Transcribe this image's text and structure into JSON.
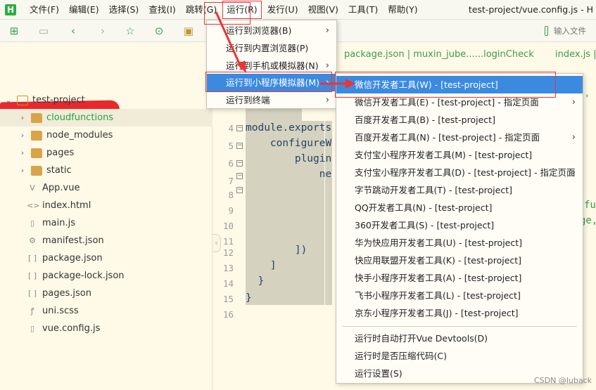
{
  "menubar": {
    "logo": "H",
    "items": [
      "文件(F)",
      "编辑(E)",
      "选择(S)",
      "查找(I)",
      "跳转(G)",
      "运行(R)",
      "发行(U)",
      "视图(V)",
      "工具(T)",
      "帮助(Y)"
    ],
    "title": "test-project/vue.config.js - H"
  },
  "toolbar": {
    "search_placeholder": "输入文件"
  },
  "sidebar": {
    "items": [
      {
        "label": "test-project",
        "type": "project",
        "arrow": "⌄"
      },
      {
        "label": "cloudfunctions",
        "type": "folder",
        "arrow": "›"
      },
      {
        "label": "node_modules",
        "type": "folder",
        "arrow": "›"
      },
      {
        "label": "pages",
        "type": "folder",
        "arrow": "›"
      },
      {
        "label": "static",
        "type": "folder",
        "arrow": "›"
      },
      {
        "label": "App.vue",
        "type": "vue",
        "icon": "V"
      },
      {
        "label": "index.html",
        "type": "html",
        "icon": "<>"
      },
      {
        "label": "main.js",
        "type": "file",
        "icon": "▯"
      },
      {
        "label": "manifest.json",
        "type": "json",
        "icon": "⚙"
      },
      {
        "label": "package.json",
        "type": "json",
        "icon": "[ ]"
      },
      {
        "label": "package-lock.json",
        "type": "json",
        "icon": "[ ]"
      },
      {
        "label": "pages.json",
        "type": "json",
        "icon": "[ ]"
      },
      {
        "label": "uni.scss",
        "type": "scss",
        "icon": "ꝭ"
      },
      {
        "label": "vue.config.js",
        "type": "file",
        "icon": "▯"
      }
    ]
  },
  "editor": {
    "tab_a": "package.json | muxin_jube......loginCheck",
    "tab_b": "index.js |",
    "line_numbers": [
      "4",
      "5",
      "6",
      "7",
      "8",
      "9",
      "10",
      "11",
      "12",
      "13",
      "14",
      "15",
      "16"
    ],
    "code_lines": [
      "module.exports",
      "    configureW",
      "        plugin",
      "            ne",
      "",
      "",
      "",
      "",
      "        ])",
      "    ]",
      "  }",
      "}",
      ""
    ],
    "right_fragments": [
      "'",
      "fur",
      "ge,"
    ]
  },
  "run_menu": {
    "items": [
      {
        "label": "运行到浏览器(B)",
        "submenu": true
      },
      {
        "label": "运行到内置浏览器(P)",
        "submenu": false
      },
      {
        "label": "运行到手机或模拟器(N)",
        "submenu": true
      },
      {
        "label": "运行到小程序模拟器(M)",
        "submenu": true
      },
      {
        "label": "运行到终端",
        "submenu": true
      }
    ]
  },
  "mp_menu": {
    "items": [
      {
        "label": "微信开发者工具(W) - [test-project]",
        "submenu": false
      },
      {
        "label": "微信开发者工具(E) - [test-project] - 指定页面",
        "submenu": true
      },
      {
        "label": "百度开发者工具(B) - [test-project]",
        "submenu": false
      },
      {
        "label": "百度开发者工具(N) - [test-project] - 指定页面",
        "submenu": true
      },
      {
        "label": "支付宝小程序开发者工具(M) - [test-project]",
        "submenu": false
      },
      {
        "label": "支付宝小程序开发者工具(D) - [test-project] - 指定页面",
        "submenu": true
      },
      {
        "label": "字节跳动开发者工具(T) - [test-project]",
        "submenu": false
      },
      {
        "label": "QQ开发者工具(N) - [test-project]",
        "submenu": false
      },
      {
        "label": "360开发者工具(S) - [test-project]",
        "submenu": false
      },
      {
        "label": "华为快应用开发者工具(U) - [test-project]",
        "submenu": false
      },
      {
        "label": "快应用联盟开发者工具(K) - [test-project]",
        "submenu": false
      },
      {
        "label": "快手小程序开发者工具(A) - [test-project]",
        "submenu": false
      },
      {
        "label": "飞书小程序开发者工具(L) - [test-project]",
        "submenu": false
      },
      {
        "label": "京东小程序开发者工具(J) - [test-project]",
        "submenu": false
      }
    ],
    "extra": [
      {
        "label": "运行时自动打开Vue Devtools(D)"
      },
      {
        "label": "运行时是否压缩代码(C)"
      },
      {
        "label": "运行设置(S)"
      }
    ]
  },
  "watermark": "CSDN @luback",
  "colors": {
    "accent_green": "#2aa04a",
    "highlight_blue": "#3b8ae0",
    "annotation_red": "#e33333"
  }
}
